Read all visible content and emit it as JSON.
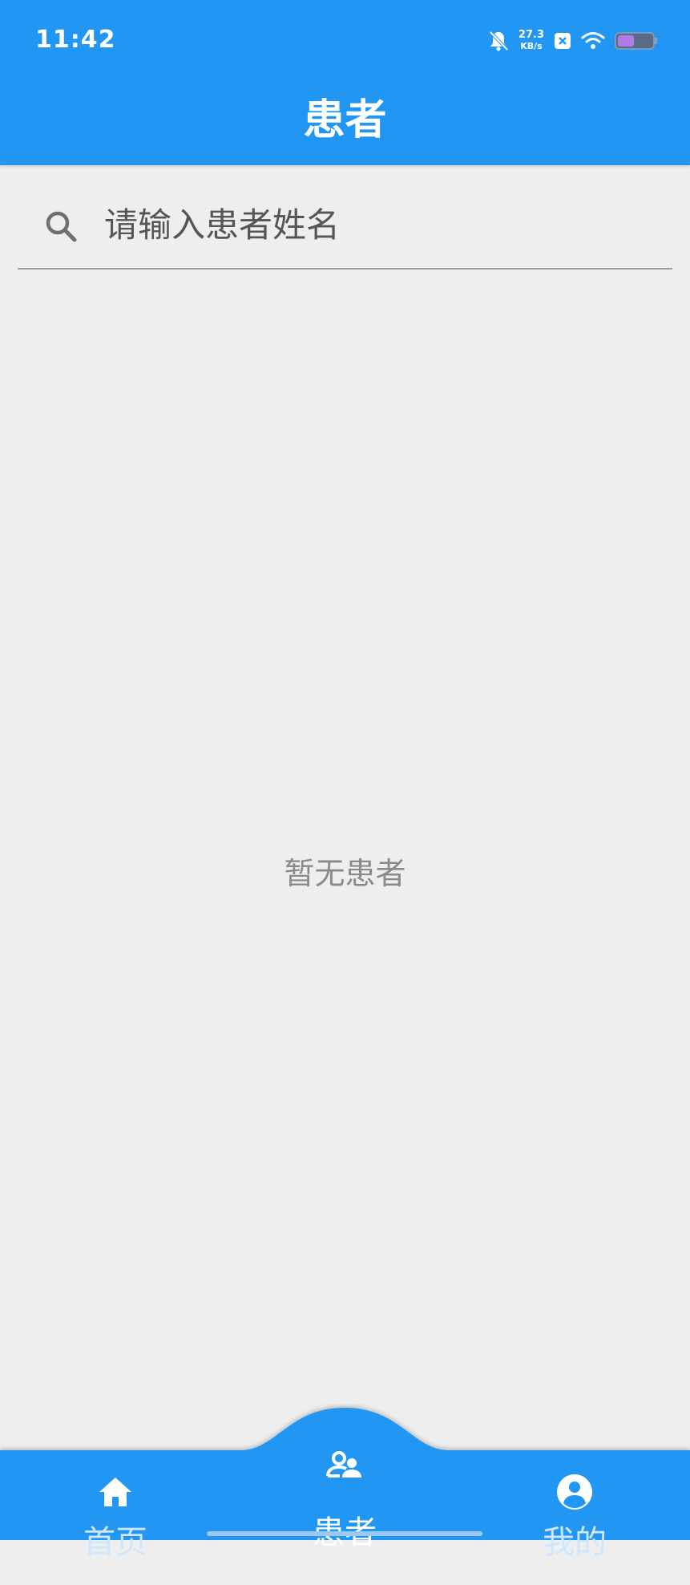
{
  "status_bar": {
    "time": "11:42",
    "net_speed_value": "27.3",
    "net_speed_unit": "KB/s",
    "icons": [
      "bell-off-icon",
      "close-box-icon",
      "wifi-icon",
      "battery-icon"
    ]
  },
  "app_bar": {
    "title": "患者"
  },
  "search": {
    "placeholder": "请输入患者姓名",
    "value": ""
  },
  "empty_state": {
    "text": "暂无患者"
  },
  "bottom_nav": {
    "items": [
      {
        "label": "首页",
        "icon": "home-icon",
        "active": false
      },
      {
        "label": "患者",
        "icon": "patients-icon",
        "active": true
      },
      {
        "label": "我的",
        "icon": "profile-icon",
        "active": false
      }
    ]
  },
  "colors": {
    "primary": "#2196f3",
    "background": "#eeeeef",
    "empty_text": "#8a8a8a"
  }
}
